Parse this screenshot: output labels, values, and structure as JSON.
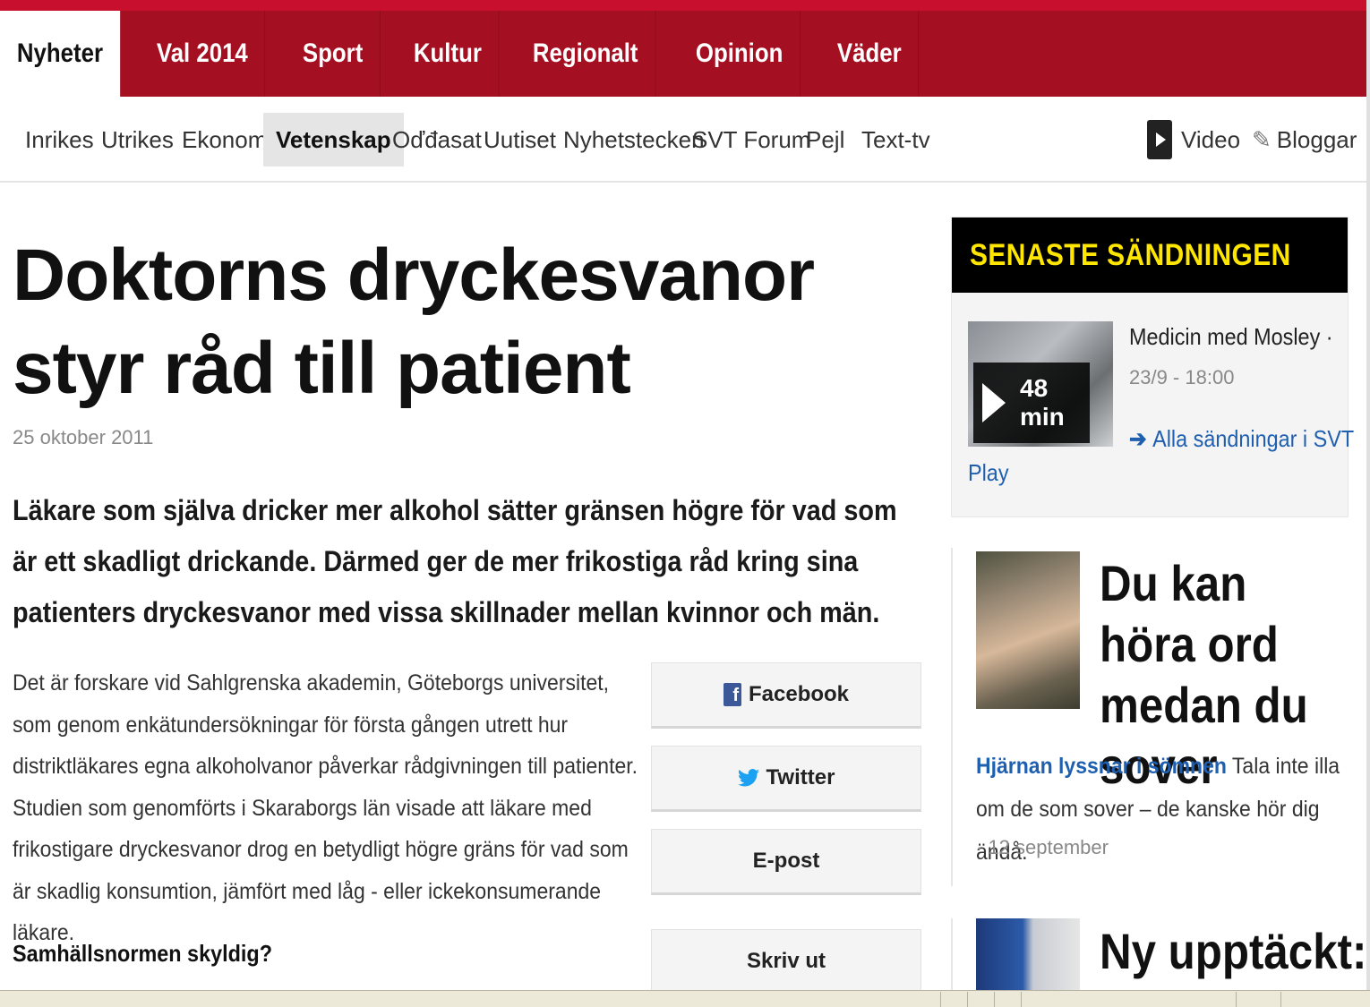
{
  "primary_nav": [
    "Nyheter",
    "Val 2014",
    "Sport",
    "Kultur",
    "Regionalt",
    "Opinion",
    "Väder"
  ],
  "secondary_nav": {
    "items": [
      "Inrikes",
      "Utrikes",
      "Ekonomi",
      "Vetenskap",
      "Oďđasat",
      "Uutiset",
      "Nyhetstecken",
      "SVT Forum",
      "Pejl",
      "Text-tv"
    ],
    "active": "Vetenskap",
    "video_label": "Video",
    "blogs_label": "Bloggar"
  },
  "article": {
    "headline": "Doktorns dryckesvanor styr råd till patient",
    "date": "25 oktober 2011",
    "lead": "Läkare som själva dricker mer alkohol sätter gränsen högre för vad som är ett skadligt drickande. Därmed ger de mer frikostiga råd kring sina patienters dryckesvanor med vissa skillnader mellan kvinnor och män.",
    "body": "Det är forskare vid Sahlgrenska akademin, Göteborgs universitet, som genom enkätundersökningar för första gången utrett hur distriktläkares egna alkoholvanor påverkar rådgivningen till patienter. Studien som genomförts i Skaraborgs län visade att läkare med frikostigare dryckesvanor drog en betydligt högre gräns för vad som är skadlig konsumtion, jämfört med låg - eller ickekonsumerande läkare.",
    "subhead": "Samhällsnormen skyldig?"
  },
  "share": {
    "facebook": "Facebook",
    "twitter": "Twitter",
    "email": "E-post",
    "print": "Skriv ut"
  },
  "broadcast": {
    "heading": "SENASTE SÄNDNINGEN",
    "duration": "48 min",
    "show_title": "Medicin med Mosley ·",
    "show_time": "23/9 - 18:00",
    "all_link_part1": "Alla sändningar i SVT",
    "all_link_part2": "Play"
  },
  "sidebar_articles": [
    {
      "title": "Du kan höra ord medan du sover",
      "teaser_link": "Hjärnan lyssnar i sömnen",
      "teaser_text": " Tala inte illa om de som sover – de kanske hör dig ändå.",
      "date": "· 12 september"
    },
    {
      "title": "Ny upptäckt:"
    }
  ],
  "colors": {
    "brand_red": "#a50f22",
    "link_blue": "#1f5fb0",
    "broadcast_yellow": "#ffe600"
  }
}
